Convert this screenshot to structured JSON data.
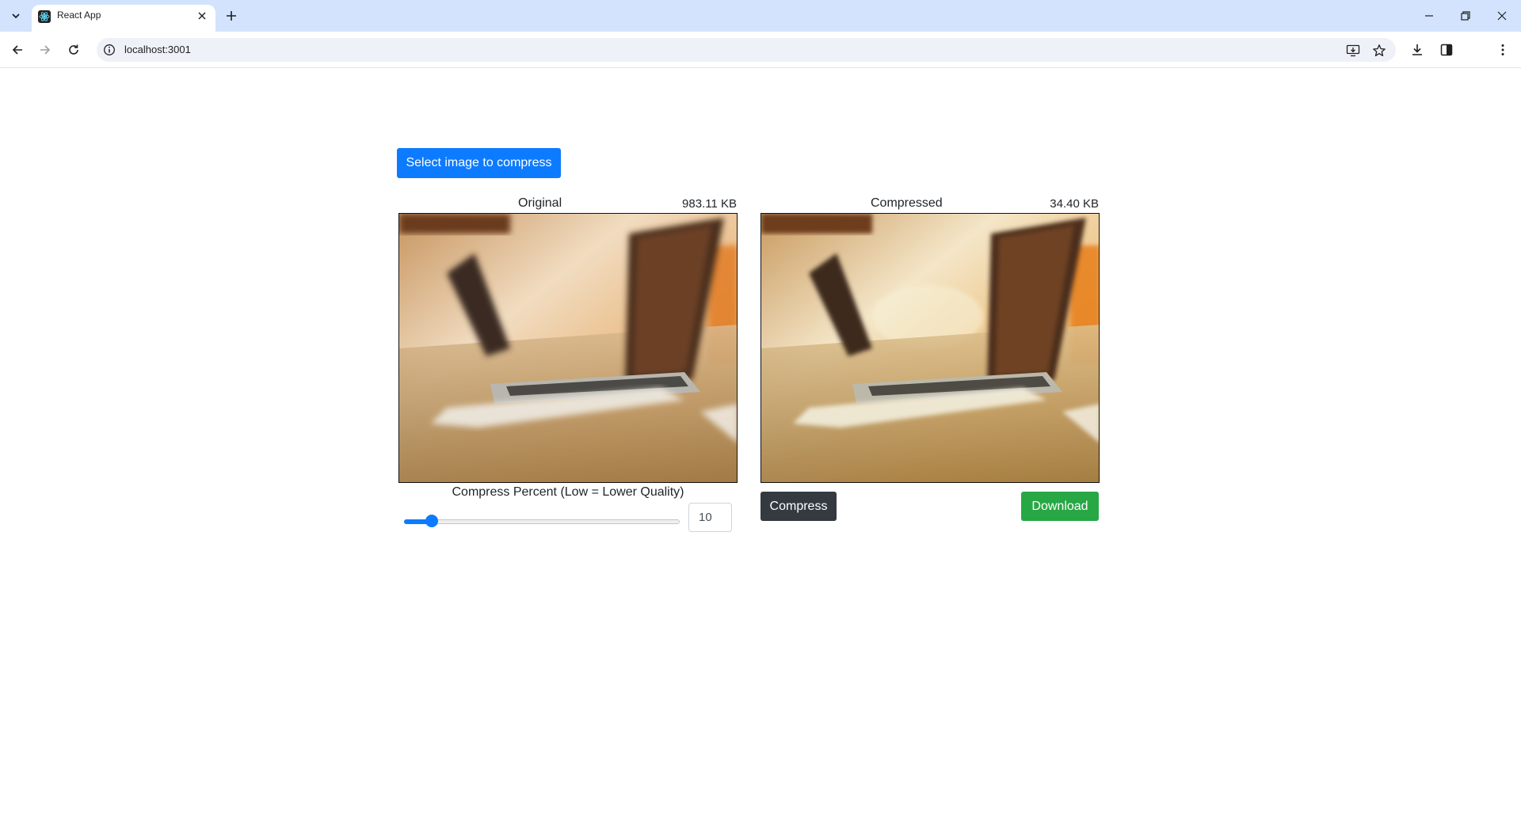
{
  "browser": {
    "tab_title": "React App",
    "url": "localhost:3001",
    "icons": {
      "tab_search": "chevron-down-icon",
      "favicon": "react-icon",
      "tab_close": "close-icon",
      "new_tab": "plus-icon",
      "back": "back-arrow-icon",
      "forward": "forward-arrow-icon",
      "reload": "reload-icon",
      "site_info": "info-icon",
      "install": "install-app-icon",
      "bookmark": "star-icon",
      "downloads": "download-icon",
      "side_panel": "side-panel-icon",
      "menu": "more-vert-icon"
    },
    "colors": {
      "tabstrip": "#d3e3fd",
      "omnibox": "#eef1f8"
    }
  },
  "app": {
    "select_button": "Select image to compress",
    "original": {
      "label": "Original",
      "size": "983.11 KB"
    },
    "compressed": {
      "label": "Compressed",
      "size": "34.40 KB"
    },
    "slider": {
      "caption": "Compress Percent (Low = Lower Quality)",
      "value": "10",
      "fraction": 0.1
    },
    "compress_button": "Compress",
    "download_button": "Download",
    "colors": {
      "primary": "#0d7bff",
      "dark": "#343a40",
      "success": "#28a745"
    }
  }
}
